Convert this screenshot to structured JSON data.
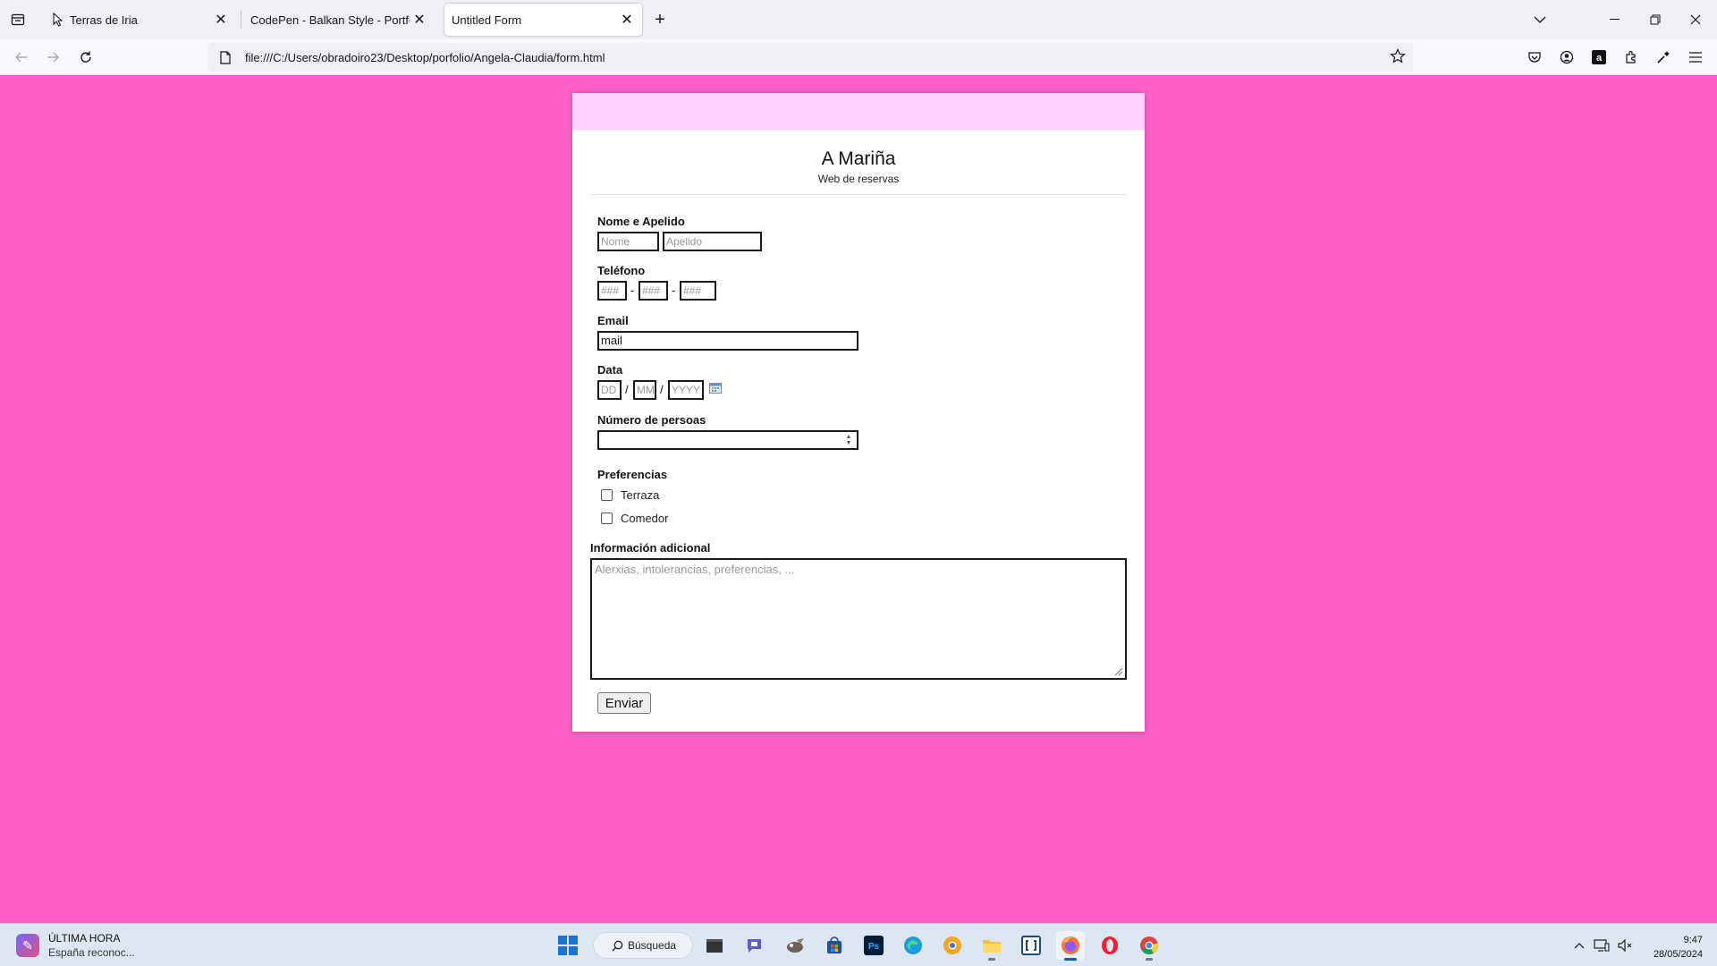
{
  "browser": {
    "tabs": [
      {
        "title": "Terras de Iria",
        "active": false
      },
      {
        "title": "CodePen - Balkan Style - Portfolio C",
        "active": false
      },
      {
        "title": "Untitled Form",
        "active": true
      }
    ],
    "url": "file:///C:/Users/obradoiro23/Desktop/porfolio/Angela-Claudia/form.html"
  },
  "page": {
    "background_color": "#ff5fc8",
    "title": "A Mariña",
    "subtitle": "Web de reservas",
    "name_section": {
      "label": "Nome e Apelido",
      "first_placeholder": "Nome",
      "last_placeholder": "Apelido"
    },
    "phone_section": {
      "label": "Teléfono",
      "part1_placeholder": "###",
      "part2_placeholder": "###",
      "part3_placeholder": "###",
      "separator": "-"
    },
    "email_section": {
      "label": "Email",
      "value": "mail"
    },
    "date_section": {
      "label": "Data",
      "day_placeholder": "DD",
      "month_placeholder": "MM",
      "year_placeholder": "YYYY",
      "separator": "/"
    },
    "people_section": {
      "label": "Número de persoas",
      "value": ""
    },
    "preferences": {
      "label": "Preferencias",
      "options": [
        {
          "label": "Terraza",
          "checked": false
        },
        {
          "label": "Comedor",
          "checked": false
        }
      ]
    },
    "info_section": {
      "label": "Información adicional",
      "placeholder": "Alerxias, intolerancias, preferencias, ..."
    },
    "submit_label": "Enviar"
  },
  "taskbar": {
    "news_title": "ÚLTIMA HORA",
    "news_subtitle": "España reconoc...",
    "search_label": "Búsqueda",
    "time": "9:47",
    "date": "28/05/2024"
  }
}
